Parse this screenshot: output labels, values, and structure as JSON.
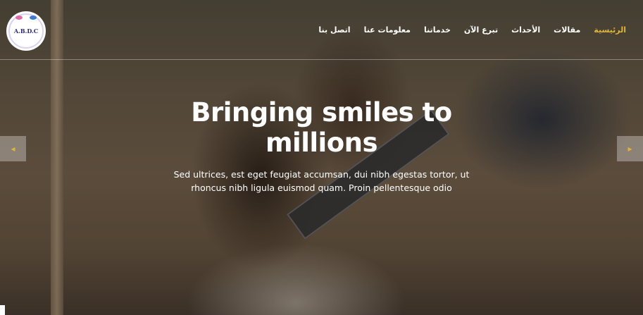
{
  "brand": {
    "logo_text": "A.B.D.C"
  },
  "nav": {
    "items": [
      {
        "label": "الرئيسية",
        "active": true
      },
      {
        "label": "مقالات",
        "active": false
      },
      {
        "label": "الأحداث",
        "active": false
      },
      {
        "label": "تبرع الآن",
        "active": false
      },
      {
        "label": "خدماتنا",
        "active": false
      },
      {
        "label": "معلومات عنا",
        "active": false
      },
      {
        "label": "اتصل بنا",
        "active": false
      }
    ]
  },
  "hero": {
    "title": "Bringing smiles to millions",
    "subtitle": "Sed ultrices, est eget feugiat accumsan, dui nibh egestas tortor, ut rhoncus nibh ligula euismod quam. Proin pellentesque odio",
    "prev_icon": "chevron-left-icon",
    "next_icon": "chevron-right-icon"
  },
  "colors": {
    "accent": "#e0b43a",
    "text": "#ffffff"
  }
}
